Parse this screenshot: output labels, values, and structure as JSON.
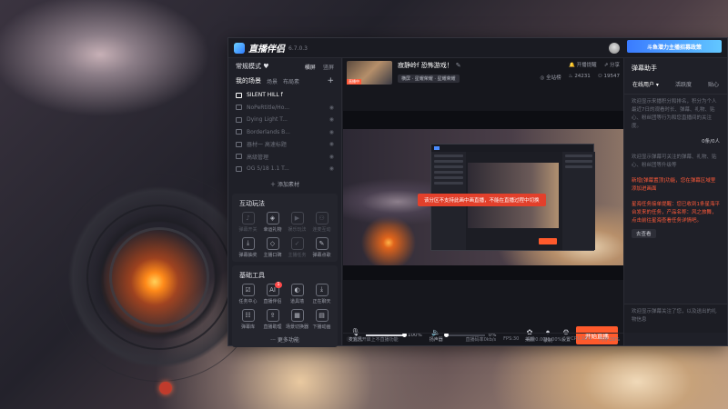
{
  "app": {
    "name": "直播伴侣",
    "version": "6.7.0.3",
    "banner": "斗鱼潜力主播招募政策"
  },
  "titlebar": {
    "notification_badge": "1"
  },
  "left": {
    "mode_label": "常规模式",
    "mode_links": [
      "横屏",
      "竖屏"
    ],
    "scene_tabs": [
      "我的场景",
      "场景",
      "布局素"
    ],
    "scenes": [
      {
        "name": "SILENT HILL f",
        "active": true
      },
      {
        "name": "NoPeRtitle/Ho...",
        "active": false
      },
      {
        "name": "Dying Light T...",
        "active": false
      },
      {
        "name": "Borderlands B...",
        "active": false
      },
      {
        "name": "器材一 高速标题",
        "active": false
      },
      {
        "name": "高级管理",
        "active": false
      },
      {
        "name": "OG 5/18 1.1 T...",
        "active": false
      }
    ],
    "add_source": "添加素材",
    "interactive": {
      "title": "互动玩法",
      "items": [
        {
          "label": "弹幕开关",
          "icon": "mic-icon",
          "dim": true
        },
        {
          "label": "幸运礼物",
          "icon": "shield-icon",
          "dim": false
        },
        {
          "label": "娱乐玩法",
          "icon": "play-icon",
          "dim": true
        },
        {
          "label": "连麦互动",
          "icon": "user-plus-icon",
          "dim": true
        },
        {
          "label": "弹幕抽奖",
          "icon": "download-icon",
          "dim": false
        },
        {
          "label": "主播口碑",
          "icon": "shield-icon",
          "dim": false
        },
        {
          "label": "主播任务",
          "icon": "check-icon",
          "dim": true
        },
        {
          "label": "弹幕点歌",
          "icon": "edit-icon",
          "dim": false
        }
      ]
    },
    "tools": {
      "title": "基础工具",
      "items": [
        {
          "label": "任务中心",
          "icon": "task-icon",
          "badge": ""
        },
        {
          "label": "直播伴侣",
          "icon": "ai-icon",
          "badge": "1"
        },
        {
          "label": "道具墙",
          "icon": "gift-icon",
          "badge": ""
        },
        {
          "label": "正在聊天",
          "icon": "download-icon",
          "badge": ""
        },
        {
          "label": "弹幕库",
          "icon": "list-icon",
          "badge": ""
        },
        {
          "label": "直播助理",
          "icon": "upload-icon",
          "badge": ""
        },
        {
          "label": "场景切换器",
          "icon": "grid-icon",
          "badge": ""
        },
        {
          "label": "下播动画",
          "icon": "film-icon",
          "badge": ""
        }
      ],
      "more": "更多功能"
    }
  },
  "center": {
    "live_title": "寂静岭f 恐怖游戏！",
    "cover_tag": "直播中",
    "category_chip": "横屏 · 星耀荣耀 · 星耀荣耀",
    "right_top": [
      "开播提醒",
      "分享"
    ],
    "right_stats": [
      "全站榜",
      "24231",
      "19547"
    ],
    "toast": "该分区不支持此画中画直播，不能在直播过程中切换",
    "controls": {
      "mic_label": "麦克风",
      "mic_pct": "100%",
      "mic_fill": 1.0,
      "speaker_label": "扬声器",
      "speaker_pct": "0%",
      "speaker_fill": 0.0,
      "beauty_label": "美颜",
      "record_label": "录制",
      "settings_label": "设置",
      "start_label": "开始直播"
    },
    "status": {
      "left": "您已开启上不直播功能",
      "stats": [
        "直播码率0kb/s",
        "FPS:30",
        "丢帧0.00(0.00%)",
        "CPU:16%",
        "内存:29%"
      ]
    }
  },
  "right": {
    "title": "弹幕助手",
    "tabs": [
      "在线用户",
      "活跃度",
      "贴心"
    ],
    "text1": "欢迎显示来播积分和排名，积分为个人最近7日的观看时长、弹幕、礼物、贴心、粉丝团等行为和您直播间的关注度。",
    "count_label": "0条/0人",
    "text2": "欢迎显示弹幕可关注的弹幕、礼物、贴心、粉丝团等升级等",
    "hl1": "新增[弹幕置顶]功能，您在弹幕区域里添加进画面",
    "hl2": "星海任务接单提醒：您已收到1条星海平台发来的任务，产品名称：风之旅舞，点击前往星海查看任务详情吧。",
    "see_button": "去查看",
    "input_hint": "欢迎显示弹幕关注了您，以及送出的礼物信息"
  },
  "colors": {
    "accent": "#ff5a2c",
    "toast": "#e2402b",
    "panel": "#1f2028",
    "banner": "#3a7bff"
  }
}
